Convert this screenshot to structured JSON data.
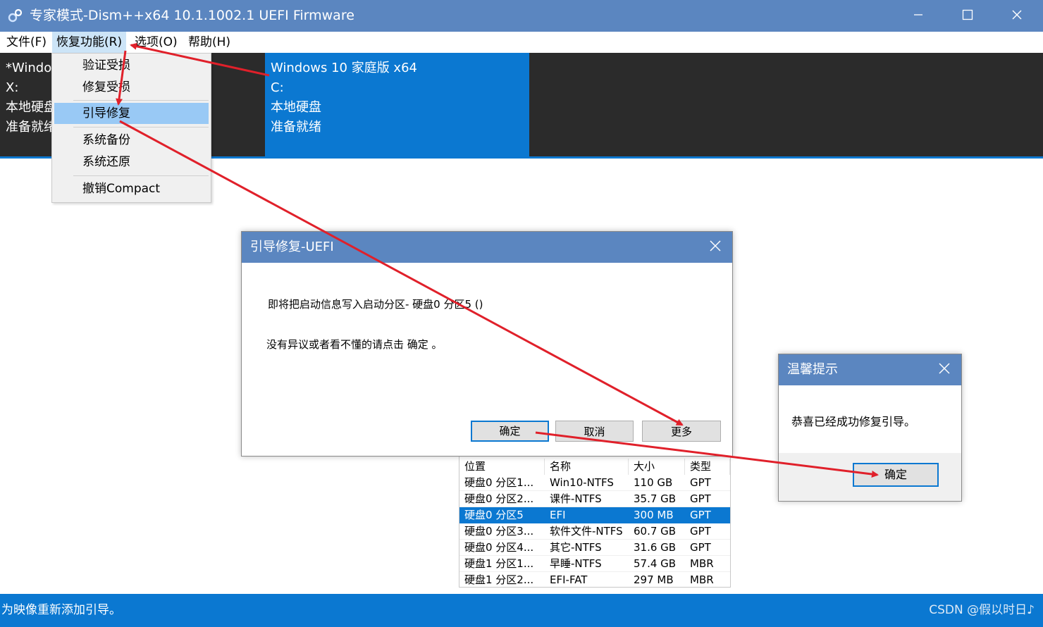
{
  "window": {
    "title": "专家模式-Dism++x64 10.1.1002.1 UEFI Firmware",
    "icons": [
      "app-logo-icon",
      "minimize-icon",
      "maximize-icon",
      "close-icon"
    ]
  },
  "menubar": {
    "file": "文件(F)",
    "recovery": "恢复功能(R)",
    "options": "选项(O)",
    "help": "帮助(H)"
  },
  "recovery_menu": {
    "items": [
      "验证受损",
      "修复受损",
      "引导修复",
      "系统备份",
      "系统还原",
      "撤销Compact"
    ],
    "highlighted": "引导修复"
  },
  "systems": [
    {
      "name": "*Windo",
      "drive": "X:",
      "disk": "本地硬盘",
      "status": "准备就绪"
    },
    {
      "name": "Windows 10 家庭版 x64",
      "drive": "C:",
      "disk": "本地硬盘",
      "status": "准备就绪"
    }
  ],
  "boot_dialog": {
    "title": "引导修复-UEFI",
    "message1": "即将把启动信息写入启动分区- 硬盘0 分区5 ()",
    "message2": "没有异议或者看不懂的请点击 确定 。",
    "ok": "确定",
    "cancel": "取消",
    "more": "更多"
  },
  "partition_table": {
    "headers": [
      "位置",
      "名称",
      "大小",
      "类型"
    ],
    "rows": [
      [
        "硬盘0 分区1...",
        "Win10-NTFS",
        "110 GB",
        "GPT"
      ],
      [
        "硬盘0 分区2...",
        "课件-NTFS",
        "35.7 GB",
        "GPT"
      ],
      [
        "硬盘0 分区5",
        "EFI",
        "300 MB",
        "GPT"
      ],
      [
        "硬盘0 分区3...",
        "软件文件-NTFS",
        "60.7 GB",
        "GPT"
      ],
      [
        "硬盘0 分区4...",
        "其它-NTFS",
        "31.6 GB",
        "GPT"
      ],
      [
        "硬盘1 分区1...",
        "早睡-NTFS",
        "57.4 GB",
        "MBR"
      ],
      [
        "硬盘1 分区2...",
        "EFI-FAT",
        "297 MB",
        "MBR"
      ]
    ],
    "selected_index": 2
  },
  "success_dialog": {
    "title": "温馨提示",
    "message": "恭喜已经成功修复引导。",
    "ok": "确定"
  },
  "statusbar": {
    "text": "为映像重新添加引导。",
    "watermark": "CSDN @假以时日♪"
  },
  "colors": {
    "titlebar": "#5b86c0",
    "accent": "#0b78d1",
    "dark_panel": "#2b2b2b",
    "menu_highlight": "#99c9f5",
    "annotation_arrow": "#e0202a"
  }
}
